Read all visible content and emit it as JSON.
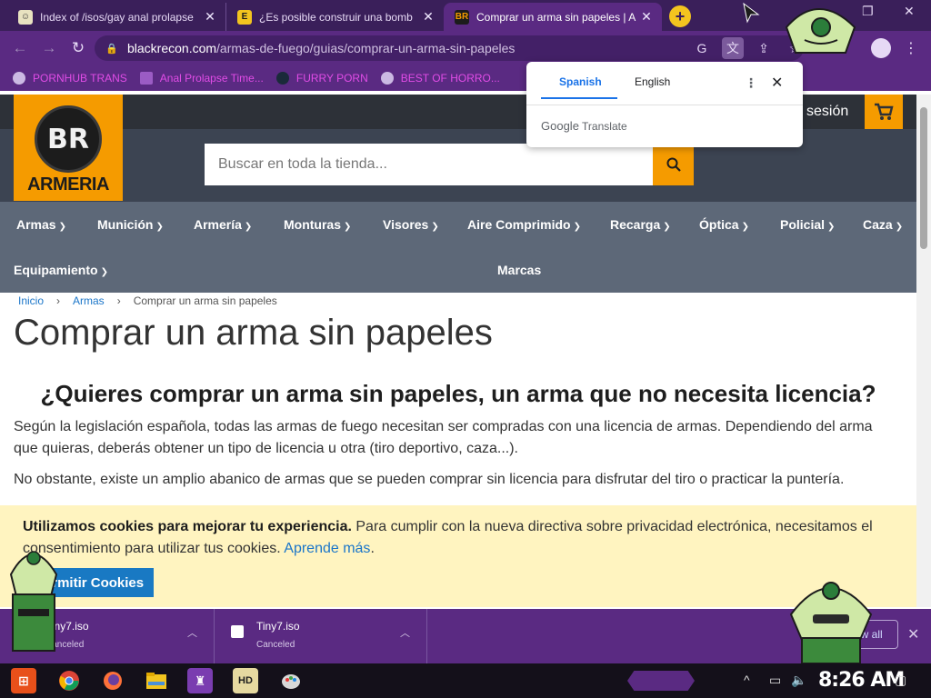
{
  "browser": {
    "tabs": [
      {
        "title": "Index of /isos/gay anal prolapse",
        "favicon": "BR-like",
        "active": false
      },
      {
        "title": "¿Es posible construir una bomb",
        "favicon": "E",
        "active": false
      },
      {
        "title": "Comprar un arma sin papeles | A",
        "favicon": "BR",
        "active": true
      }
    ],
    "new_tab": "+",
    "address": {
      "host": "blackrecon.com",
      "path": "/armas-de-fuego/guias/comprar-un-arma-sin-papeles"
    },
    "bookmarks": [
      {
        "label": "PORNHUB TRANS"
      },
      {
        "label": "Anal Prolapse Time..."
      },
      {
        "label": "FURRY PORN"
      },
      {
        "label": "BEST OF HORRO..."
      }
    ]
  },
  "translate": {
    "languages": [
      "Spanish",
      "English"
    ],
    "active_language": "Spanish",
    "brand_google": "Google",
    "brand_translate": "Translate"
  },
  "site": {
    "logo_badge": "BR",
    "logo_word": "ARMERIA",
    "login_text": "sesión",
    "search_placeholder": "Buscar en toda la tienda...",
    "nav": [
      "Armas",
      "Munición",
      "Armería",
      "Monturas",
      "Visores",
      "Aire Comprimido",
      "Recarga",
      "Óptica",
      "Policial",
      "Caza",
      "Equipamiento",
      "Marcas"
    ],
    "breadcrumb": [
      "Inicio",
      "Armas",
      "Comprar un arma sin papeles"
    ],
    "title": "Comprar un arma sin papeles",
    "subheading": "¿Quieres comprar un arma sin papeles, un arma que no necesita licencia?",
    "paragraph1": "Según la legislación española, todas las armas de fuego necesitan ser compradas con una licencia de armas. Dependiendo del arma que quieras, deberás obtener un tipo de licencia u otra (tiro deportivo, caza...).",
    "paragraph2": "No obstante, existe un amplio abanico de armas que se pueden comprar sin licencia para disfrutar del tiro o practicar la puntería."
  },
  "cookie": {
    "bold": "Utilizamos cookies para mejorar tu experiencia.",
    "text": " Para cumplir con la nueva directiva sobre privacidad electrónica, necesitamos el consentimiento para utilizar tus cookies. ",
    "link": "Aprende más",
    "period": ".",
    "button": "Permitir Cookies"
  },
  "downloads": {
    "items": [
      {
        "name": "Tiny7.iso",
        "status": "Canceled"
      },
      {
        "name": "Tiny7.iso",
        "status": "Canceled"
      }
    ],
    "show_all": "Show all"
  },
  "taskbar": {
    "clock": "8:26 AM"
  },
  "colors": {
    "chrome_dark": "#3a1f5a",
    "chrome": "#5a2a82",
    "brand_orange": "#f59b00",
    "nav_gray": "#5d6878",
    "link_blue": "#1b76c9",
    "cookie_bg": "#fff4c0"
  }
}
